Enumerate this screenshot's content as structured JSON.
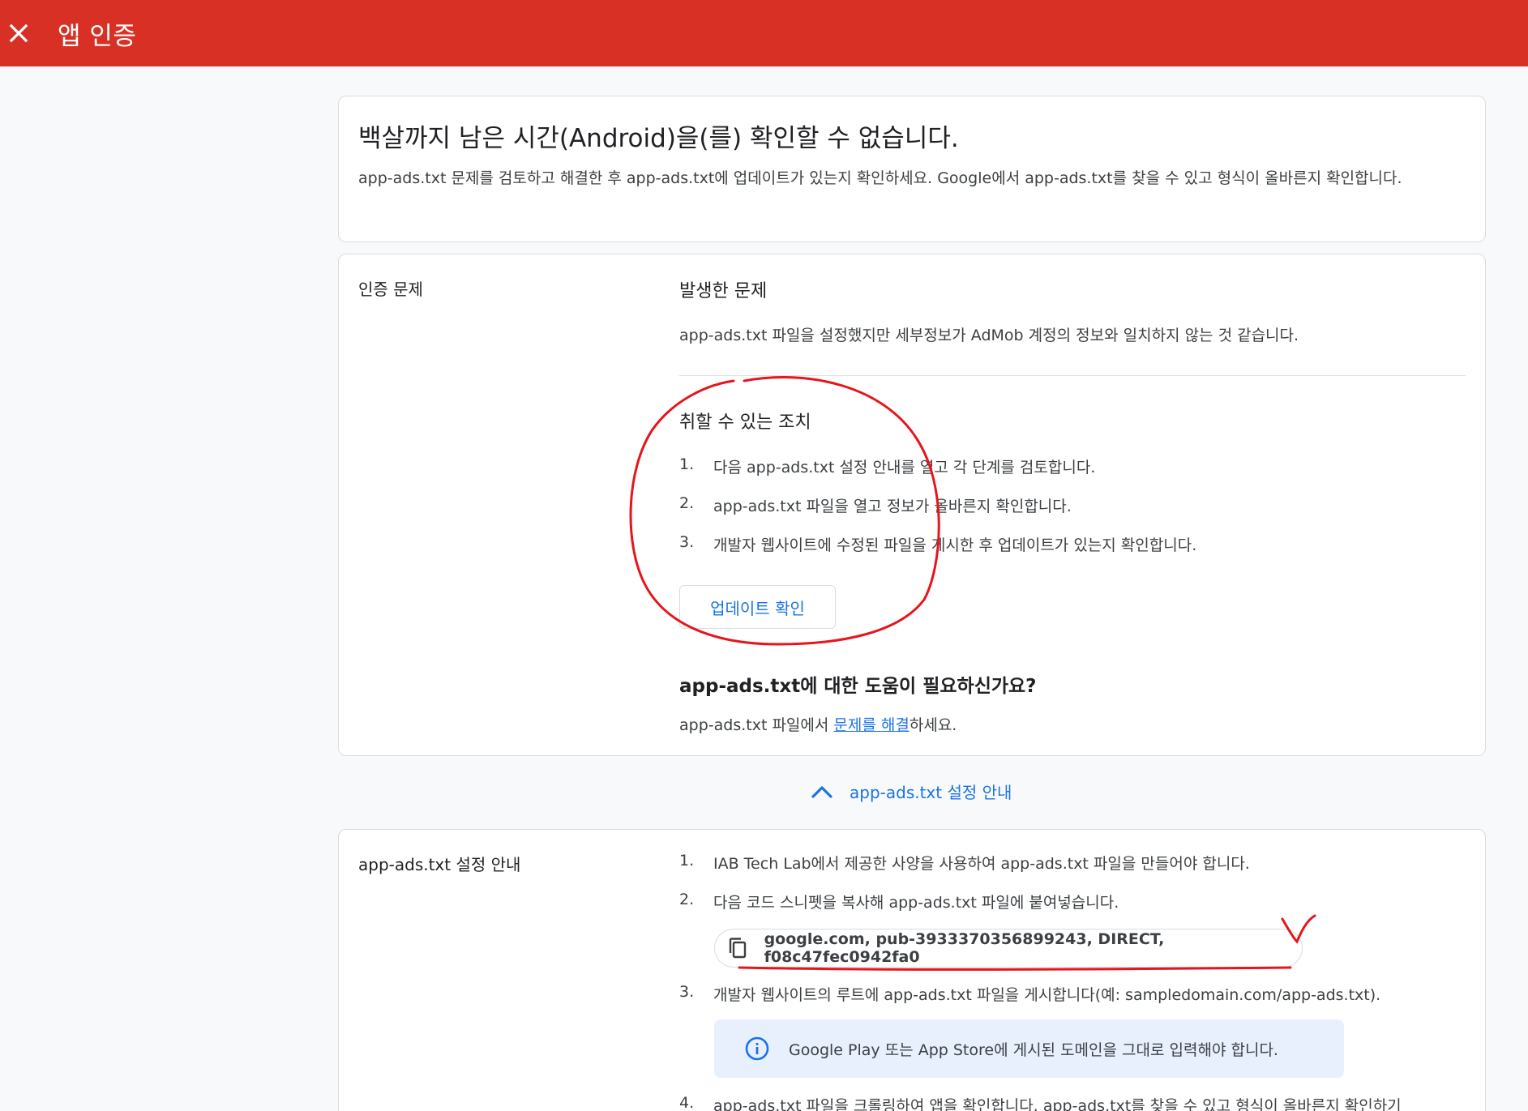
{
  "header": {
    "title": "앱 인증",
    "background_color": "#d93025"
  },
  "summary": {
    "title": "백살까지 남은 시간(Android)을(를) 확인할 수 없습니다.",
    "description": "app-ads.txt 문제를 검토하고 해결한 후 app-ads.txt에 업데이트가 있는지 확인하세요. Google에서 app-ads.txt를 찾을 수 있고 형식이 올바른지 확인합니다."
  },
  "issue_section": {
    "label": "인증 문제",
    "problem_title": "발생한 문제",
    "problem_text": "app-ads.txt 파일을 설정했지만 세부정보가 AdMob 계정의 정보와 일치하지 않는 것 같습니다.",
    "actions_title": "취할 수 있는 조치",
    "actions": [
      {
        "num": "1.",
        "text": "다음 app-ads.txt 설정 안내를 열고 각 단계를 검토합니다."
      },
      {
        "num": "2.",
        "text": "app-ads.txt 파일을 열고 정보가 올바른지 확인합니다."
      },
      {
        "num": "3.",
        "text": "개발자 웹사이트에 수정된 파일을 게시한 후 업데이트가 있는지 확인합니다."
      }
    ],
    "check_button": "업데이트 확인",
    "help_title": "app-ads.txt에 대한 도움이 필요하신가요?",
    "help_prefix": "app-ads.txt 파일에서 ",
    "help_link": "문제를 해결",
    "help_suffix": "하세요."
  },
  "toggle": {
    "label": "app-ads.txt 설정 안내",
    "accent_color": "#1a73e8"
  },
  "setup_section": {
    "label": "app-ads.txt 설정 안내",
    "steps": [
      {
        "num": "1.",
        "text": "IAB Tech Lab에서 제공한 사양을 사용하여 app-ads.txt 파일을 만들어야 합니다."
      },
      {
        "num": "2.",
        "text": "다음 코드 스니펫을 복사해 app-ads.txt 파일에 붙여넣습니다."
      },
      {
        "num": "3.",
        "text": "개발자 웹사이트의 루트에 app-ads.txt 파일을 게시합니다(예: sampledomain.com/app-ads.txt)."
      },
      {
        "num": "4.",
        "text": "app-ads.txt 파일을 크롤링하여 앱을 확인합니다. app-ads.txt를 찾을 수 있고 형식이 올바른지 확인하기"
      }
    ],
    "snippet": "google.com, pub-3933370356899243, DIRECT, f08c47fec0942fa0",
    "notice": "Google Play 또는 App Store에 게시된 도메인을 그대로 입력해야 합니다."
  },
  "annotation_color": "#e8141b"
}
